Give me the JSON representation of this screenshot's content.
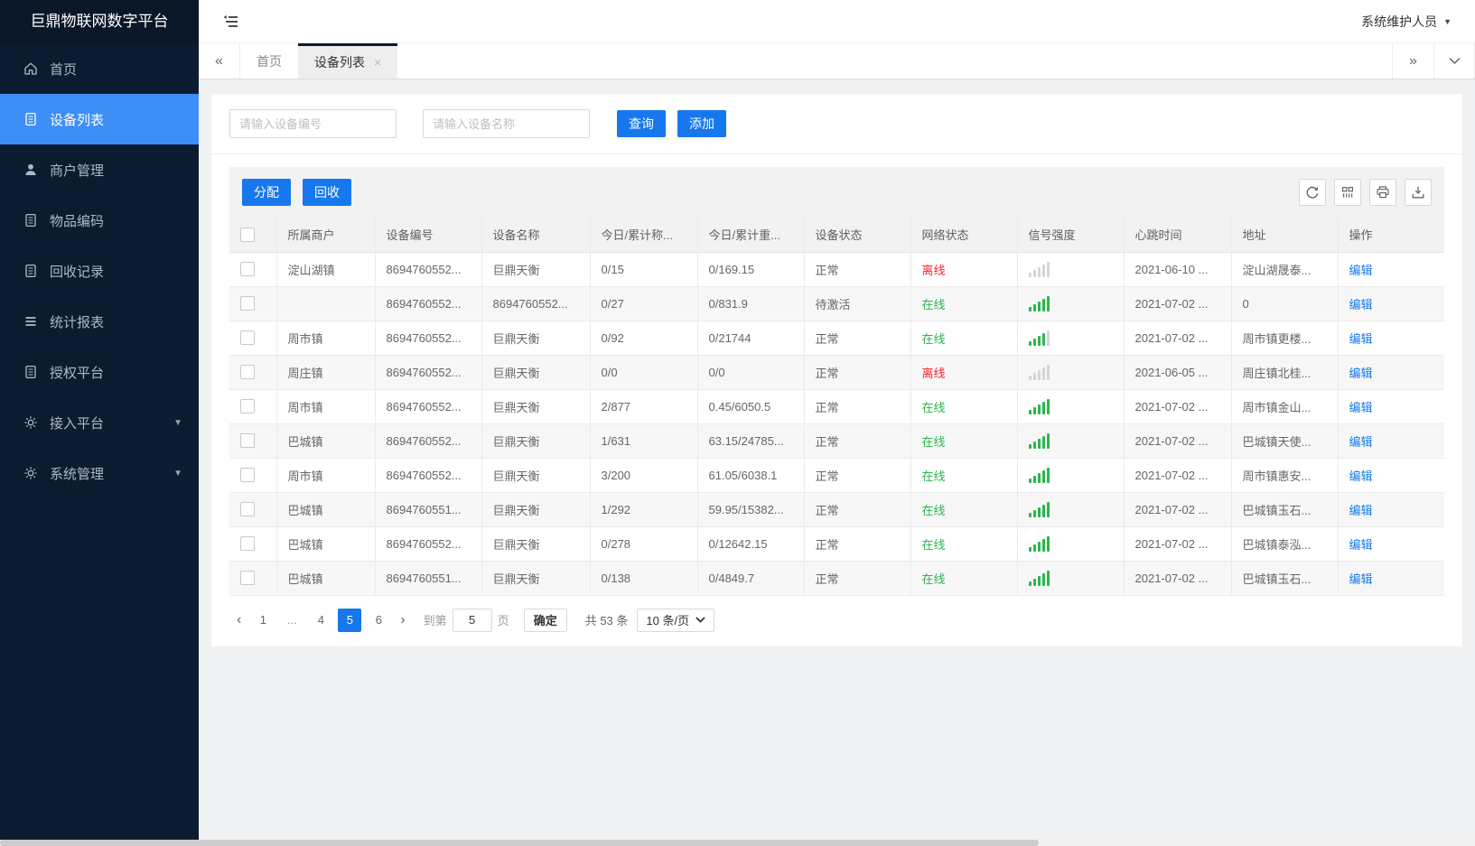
{
  "app": {
    "title": "巨鼎物联网数字平台",
    "user_menu": "系统维护人员"
  },
  "sidebar": {
    "items": [
      {
        "label": "首页",
        "icon": "home",
        "active": false,
        "expandable": false
      },
      {
        "label": "设备列表",
        "icon": "doc",
        "active": true,
        "expandable": false
      },
      {
        "label": "商户管理",
        "icon": "user",
        "active": false,
        "expandable": false
      },
      {
        "label": "物品编码",
        "icon": "doc",
        "active": false,
        "expandable": false
      },
      {
        "label": "回收记录",
        "icon": "doc",
        "active": false,
        "expandable": false
      },
      {
        "label": "统计报表",
        "icon": "lines",
        "active": false,
        "expandable": false
      },
      {
        "label": "授权平台",
        "icon": "doc",
        "active": false,
        "expandable": false
      },
      {
        "label": "接入平台",
        "icon": "gear",
        "active": false,
        "expandable": true
      },
      {
        "label": "系统管理",
        "icon": "gear",
        "active": false,
        "expandable": true
      }
    ]
  },
  "tabbar": {
    "tabs": [
      {
        "label": "首页",
        "active": false,
        "closable": false
      },
      {
        "label": "设备列表",
        "active": true,
        "closable": true
      }
    ]
  },
  "filters": {
    "device_no_placeholder": "请输入设备编号",
    "device_name_placeholder": "请输入设备名称",
    "query_label": "查询",
    "add_label": "添加"
  },
  "actions": {
    "assign_label": "分配",
    "recycle_label": "回收"
  },
  "table": {
    "headers": [
      "所属商户",
      "设备编号",
      "设备名称",
      "今日/累计称...",
      "今日/累计重...",
      "设备状态",
      "网络状态",
      "信号强度",
      "心跳时间",
      "地址",
      "操作"
    ],
    "edit_label": "编辑",
    "rows": [
      {
        "merchant": "淀山湖镇",
        "device_no": "8694760552...",
        "device_name": "巨鼎天衡",
        "count": "0/15",
        "weight": "0/169.15",
        "status": "正常",
        "network": "离线",
        "online": false,
        "signal": 0,
        "heartbeat": "2021-06-10 ...",
        "address": "淀山湖晟泰..."
      },
      {
        "merchant": "",
        "device_no": "8694760552...",
        "device_name": "8694760552...",
        "count": "0/27",
        "weight": "0/831.9",
        "status": "待激活",
        "network": "在线",
        "online": true,
        "signal": 5,
        "heartbeat": "2021-07-02 ...",
        "address": "0"
      },
      {
        "merchant": "周市镇",
        "device_no": "8694760552...",
        "device_name": "巨鼎天衡",
        "count": "0/92",
        "weight": "0/21744",
        "status": "正常",
        "network": "在线",
        "online": true,
        "signal": 4,
        "heartbeat": "2021-07-02 ...",
        "address": "周市镇更楼..."
      },
      {
        "merchant": "周庄镇",
        "device_no": "8694760552...",
        "device_name": "巨鼎天衡",
        "count": "0/0",
        "weight": "0/0",
        "status": "正常",
        "network": "离线",
        "online": false,
        "signal": 0,
        "heartbeat": "2021-06-05 ...",
        "address": "周庄镇北桂..."
      },
      {
        "merchant": "周市镇",
        "device_no": "8694760552...",
        "device_name": "巨鼎天衡",
        "count": "2/877",
        "weight": "0.45/6050.5",
        "status": "正常",
        "network": "在线",
        "online": true,
        "signal": 5,
        "heartbeat": "2021-07-02 ...",
        "address": "周市镇金山..."
      },
      {
        "merchant": "巴城镇",
        "device_no": "8694760552...",
        "device_name": "巨鼎天衡",
        "count": "1/631",
        "weight": "63.15/24785...",
        "status": "正常",
        "network": "在线",
        "online": true,
        "signal": 5,
        "heartbeat": "2021-07-02 ...",
        "address": "巴城镇天使..."
      },
      {
        "merchant": "周市镇",
        "device_no": "8694760552...",
        "device_name": "巨鼎天衡",
        "count": "3/200",
        "weight": "61.05/6038.1",
        "status": "正常",
        "network": "在线",
        "online": true,
        "signal": 5,
        "heartbeat": "2021-07-02 ...",
        "address": "周市镇惠安..."
      },
      {
        "merchant": "巴城镇",
        "device_no": "8694760551...",
        "device_name": "巨鼎天衡",
        "count": "1/292",
        "weight": "59.95/15382...",
        "status": "正常",
        "network": "在线",
        "online": true,
        "signal": 5,
        "heartbeat": "2021-07-02 ...",
        "address": "巴城镇玉石..."
      },
      {
        "merchant": "巴城镇",
        "device_no": "8694760552...",
        "device_name": "巨鼎天衡",
        "count": "0/278",
        "weight": "0/12642.15",
        "status": "正常",
        "network": "在线",
        "online": true,
        "signal": 5,
        "heartbeat": "2021-07-02 ...",
        "address": "巴城镇泰泓..."
      },
      {
        "merchant": "巴城镇",
        "device_no": "8694760551...",
        "device_name": "巨鼎天衡",
        "count": "0/138",
        "weight": "0/4849.7",
        "status": "正常",
        "network": "在线",
        "online": true,
        "signal": 5,
        "heartbeat": "2021-07-02 ...",
        "address": "巴城镇玉石..."
      }
    ]
  },
  "pagination": {
    "pages": [
      "1",
      "...",
      "4",
      "5",
      "6"
    ],
    "active_page": "5",
    "goto_label": "到第",
    "goto_value": "5",
    "page_unit_label": "页",
    "confirm_label": "确定",
    "total_label": "共 53 条",
    "page_size_label": "10 条/页"
  },
  "colors": {
    "accent_blue": "#1678ec",
    "sidebar_active_blue": "#3e8ef7",
    "sidebar_bg": "#0c1c30",
    "online_green": "#2db54d",
    "offline_red": "#f5222d"
  }
}
